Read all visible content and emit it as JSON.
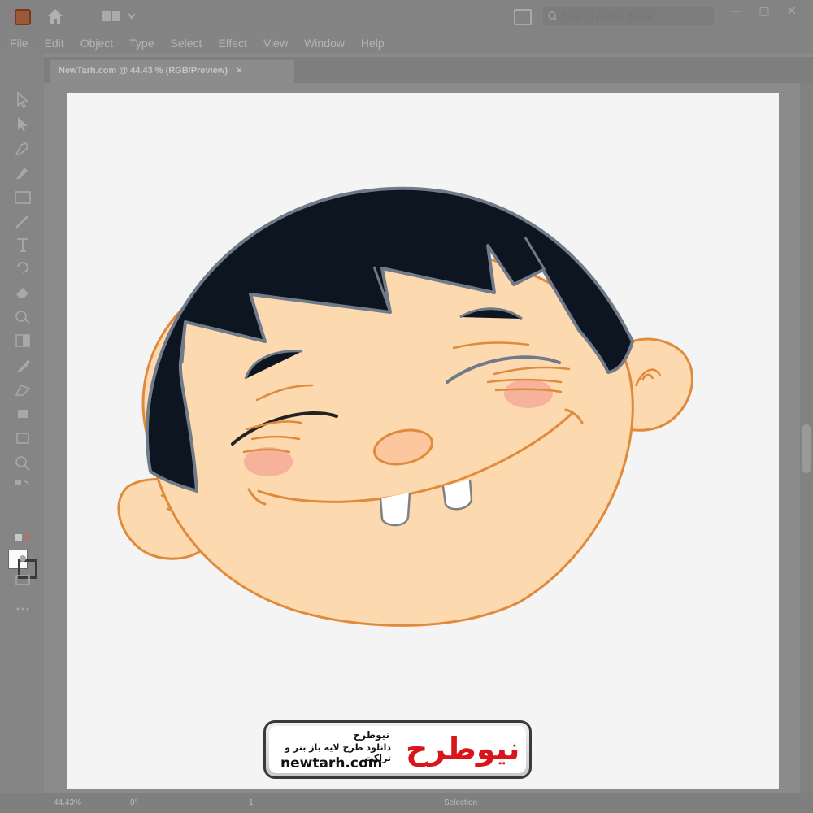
{
  "app": {
    "menu": [
      "File",
      "Edit",
      "Object",
      "Type",
      "Select",
      "Effect",
      "View",
      "Window",
      "Help"
    ],
    "search_placeholder": "Search Adobe Stock",
    "document_tab": "NewTarh.com @ 44.43 % (RGB/Preview)",
    "tab_close": "×"
  },
  "status": {
    "zoom": "44.43%",
    "rotation": "0°",
    "artboard_nav": "1",
    "mode": "Selection"
  },
  "watermark": {
    "site_name": "نیوطرح",
    "tagline": "دانلود طرح لایه باز بنر و تراکت",
    "url": "newtarh.com",
    "wordmark": "نیوطرح",
    "brand_color": "#d9151b"
  },
  "colors": {
    "skin": "#fdd9b0",
    "skin_outline": "#e08a3c",
    "hair": "#0d1521",
    "hair_outline": "#707a88",
    "cheek": "#f6b29a",
    "tooth": "#ffffff"
  },
  "icons": [
    "app-icon",
    "home-icon",
    "workspace-switcher-icon",
    "arrange-documents-icon",
    "search-icon",
    "minimize-icon",
    "restore-icon",
    "close-icon"
  ]
}
